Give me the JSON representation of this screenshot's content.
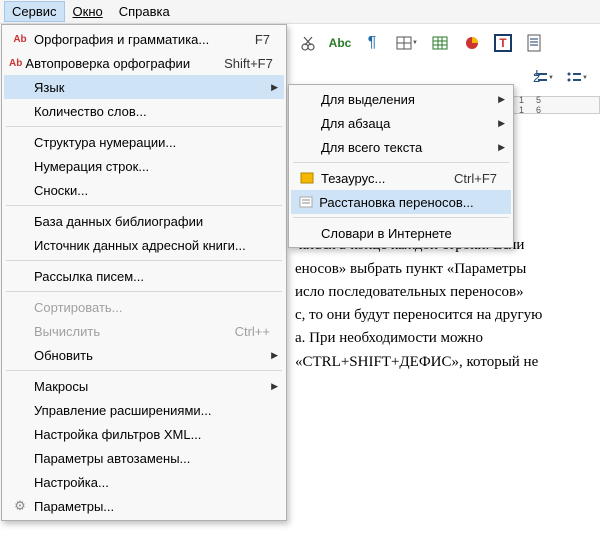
{
  "menubar": {
    "service": "Сервис",
    "window": "Окно",
    "help": "Справка"
  },
  "main_menu": {
    "spellgrammar": "Орфография и грамматика...",
    "spellgrammar_sc": "F7",
    "autospell": "Автопроверка орфографии",
    "autospell_sc": "Shift+F7",
    "language": "Язык",
    "wordcount": "Количество слов...",
    "numbering": "Структура нумерации...",
    "linenum": "Нумерация строк...",
    "footnotes": "Сноски...",
    "bibdb": "База данных библиографии",
    "addrbook": "Источник данных адресной книги...",
    "mailmerge": "Рассылка писем...",
    "sort": "Сортировать...",
    "calc": "Вычислить",
    "calc_sc": "Ctrl++",
    "refresh": "Обновить",
    "macros": "Макросы",
    "extmgr": "Управление расширениями...",
    "xmlfilter": "Настройка фильтров XML...",
    "autocorr": "Параметры автозамены...",
    "customize": "Настройка...",
    "options": "Параметры..."
  },
  "sub_menu": {
    "for_selection": "Для выделения",
    "for_paragraph": "Для абзаца",
    "for_all": "Для всего текста",
    "thesaurus": "Тезаурус...",
    "thesaurus_sc": "Ctrl+F7",
    "hyphenation": "Расстановка переносов...",
    "dictionaries": "Словари в Интернете"
  },
  "toolbar": {
    "abc_label": "Abc"
  },
  "ruler": {
    "ticks": "15  16"
  },
  "doc_text": "рде вручную можно только после\nнию Word предлагает различные\nв котором необходимо указать\n\n\nчаться в конце каждой строки. Если\nеносов» выбрать пункт «Параметры\nисло последовательных переносов»\nс, то они будут переносится на другую\nа. При необходимости можно\n«CTRL+SHIFT+ДЕФИС», который не"
}
